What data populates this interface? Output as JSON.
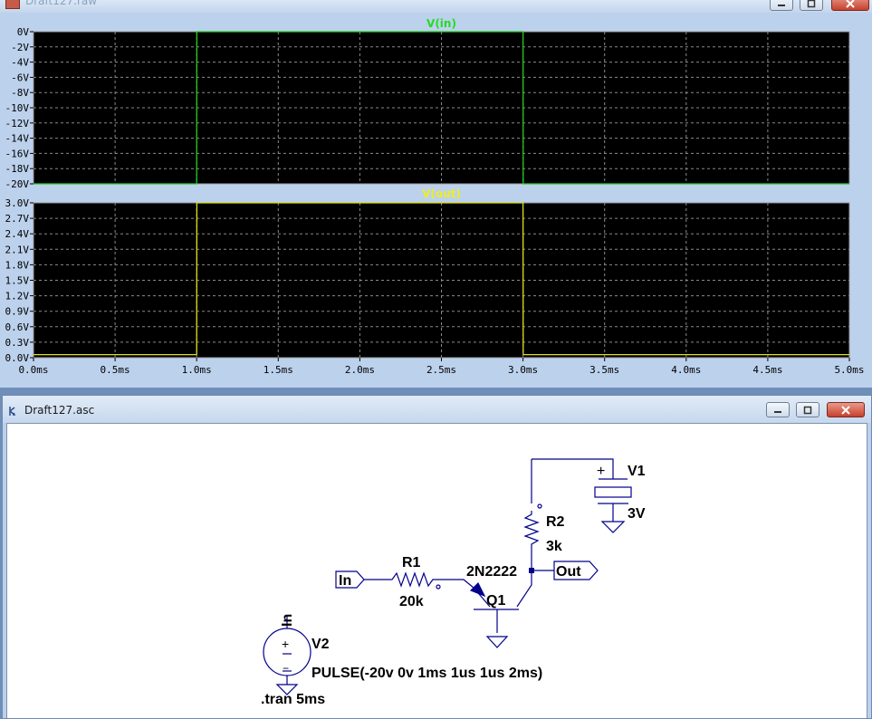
{
  "waveform_window": {
    "title": "Draft127.raw",
    "buttons": {
      "minimize": "minimize",
      "maximize": "maximize",
      "close": "close"
    }
  },
  "chart_data": [
    {
      "type": "line",
      "title": "V(in)",
      "title_color": "#22dd22",
      "line_color": "#22cc22",
      "ylim": [
        -20,
        0
      ],
      "yticks": [
        0,
        -2,
        -4,
        -6,
        -8,
        -10,
        -12,
        -14,
        -16,
        -18,
        -20
      ],
      "ytick_labels": [
        "0V",
        "-2V",
        "-4V",
        "-6V",
        "-8V",
        "-10V",
        "-12V",
        "-14V",
        "-16V",
        "-18V",
        "-20V"
      ],
      "xlim": [
        0,
        5
      ],
      "grid": true,
      "series": [
        {
          "name": "V(in)",
          "x": [
            0,
            1.0,
            1.001,
            3.0,
            3.001,
            5.0
          ],
          "y": [
            -20,
            -20,
            0,
            0,
            -20,
            -20
          ]
        }
      ]
    },
    {
      "type": "line",
      "title": "V(out)",
      "title_color": "#eeee22",
      "line_color": "#dddd22",
      "ylim": [
        0,
        3.0
      ],
      "yticks": [
        3.0,
        2.7,
        2.4,
        2.1,
        1.8,
        1.5,
        1.2,
        0.9,
        0.6,
        0.3,
        0.0
      ],
      "ytick_labels": [
        "3.0V",
        "2.7V",
        "2.4V",
        "2.1V",
        "1.8V",
        "1.5V",
        "1.2V",
        "0.9V",
        "0.6V",
        "0.3V",
        "0.0V"
      ],
      "xlim": [
        0,
        5
      ],
      "xticks": [
        0,
        0.5,
        1.0,
        1.5,
        2.0,
        2.5,
        3.0,
        3.5,
        4.0,
        4.5,
        5.0
      ],
      "xtick_labels": [
        "0.0ms",
        "0.5ms",
        "1.0ms",
        "1.5ms",
        "2.0ms",
        "2.5ms",
        "3.0ms",
        "3.5ms",
        "4.0ms",
        "4.5ms",
        "5.0ms"
      ],
      "grid": true,
      "series": [
        {
          "name": "V(out)",
          "x": [
            0,
            1.0,
            1.001,
            3.0,
            3.001,
            5.0
          ],
          "y": [
            0.06,
            0.06,
            3.0,
            3.0,
            0.06,
            0.06
          ]
        }
      ]
    }
  ],
  "schematic_window": {
    "title": "Draft127.asc",
    "buttons": {
      "minimize": "minimize",
      "maximize": "maximize",
      "close": "close"
    },
    "components": {
      "v1": {
        "name": "V1",
        "value": "3V",
        "plus": "+"
      },
      "r2": {
        "name": "R2",
        "value": "3k"
      },
      "r1": {
        "name": "R1",
        "value": "20k"
      },
      "q1": {
        "name": "Q1",
        "model": "2N2222"
      },
      "v2": {
        "name": "V2",
        "value": "PULSE(-20v 0v 1ms 1us 1us 2ms)",
        "plus": "+",
        "minus": "−"
      }
    },
    "net_labels": {
      "in": "In",
      "out": "Out",
      "v2_top": "In"
    },
    "directive": ".tran 5ms"
  }
}
